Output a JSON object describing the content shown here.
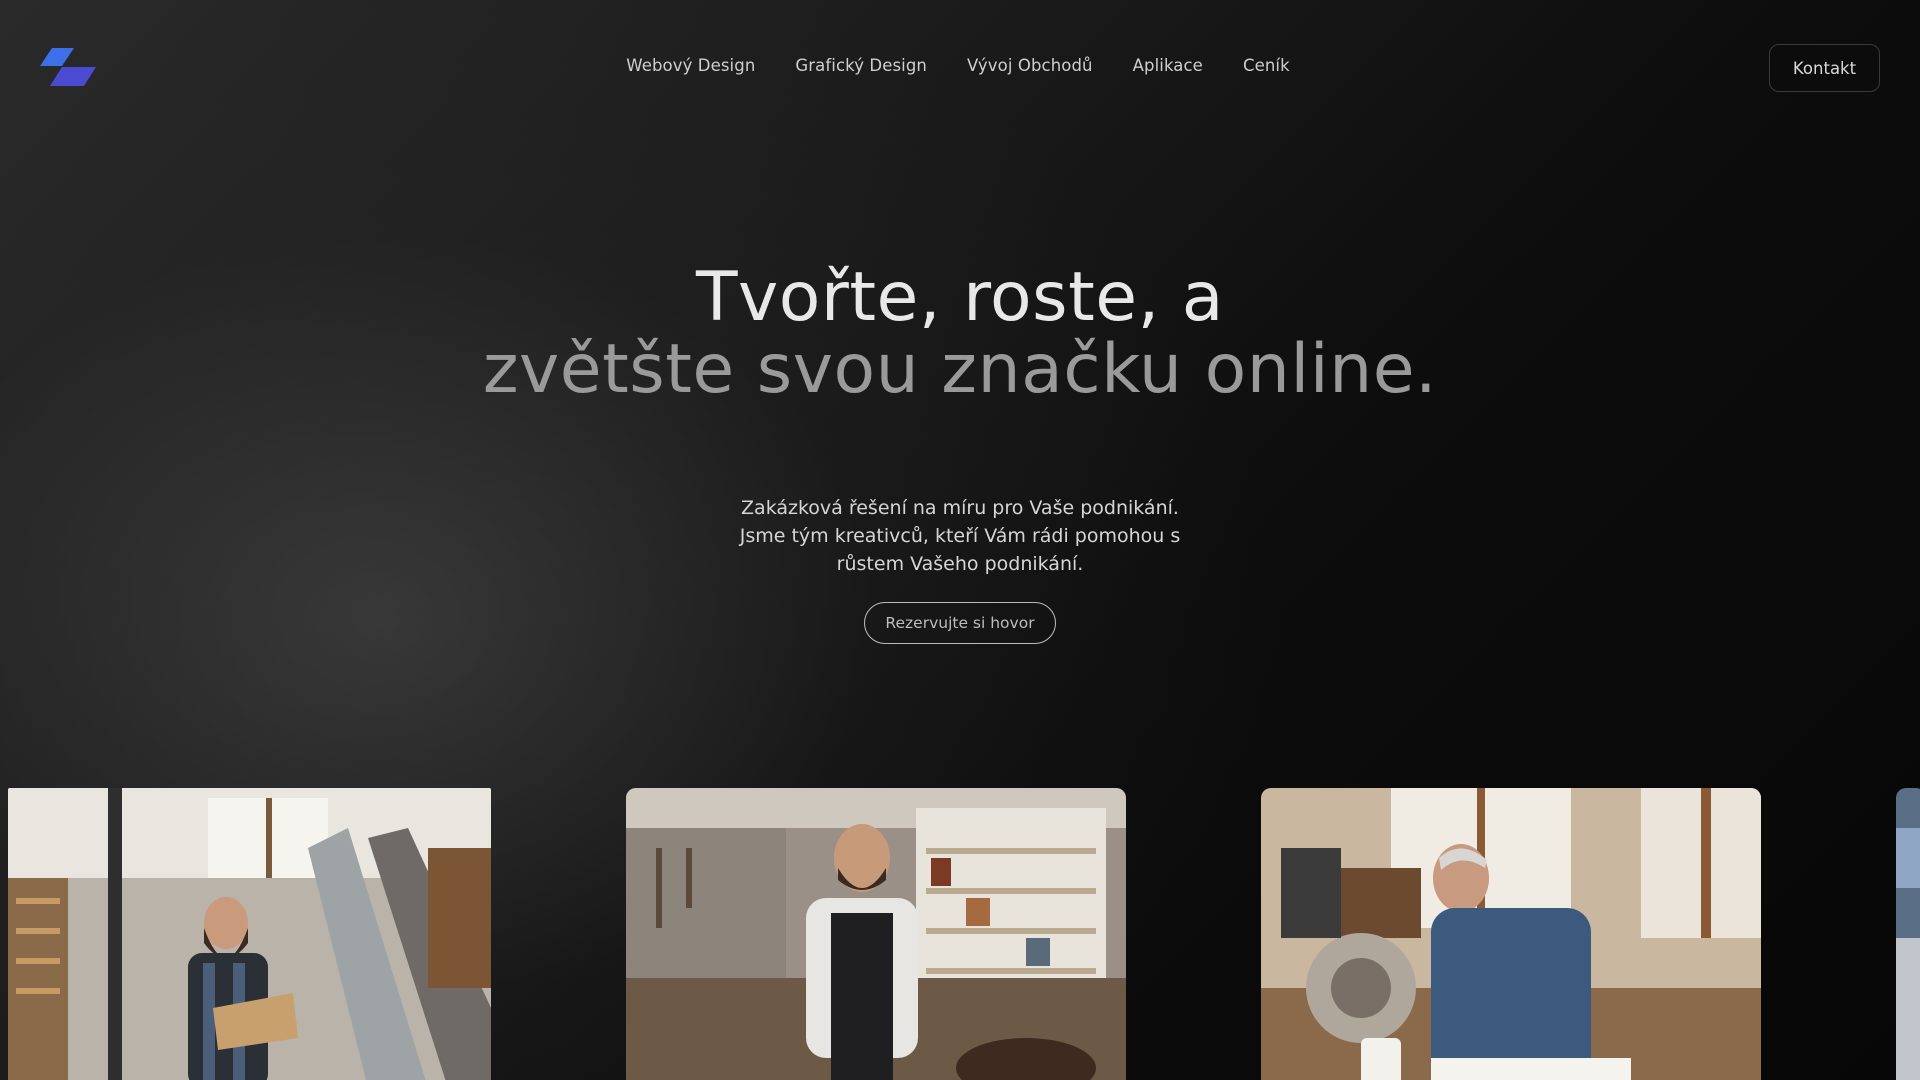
{
  "header": {
    "logo_icon": "brand-parallelogram-logo",
    "nav": [
      {
        "label": "Webový Design"
      },
      {
        "label": "Grafický Design"
      },
      {
        "label": "Vývoj Obchodů"
      },
      {
        "label": "Aplikace"
      },
      {
        "label": "Ceník"
      }
    ],
    "contact_label": "Kontakt"
  },
  "hero": {
    "title_line1": "Tvořte, roste, a",
    "title_line2": "zvětšte svou značku online.",
    "subtitle_lines": [
      "Zakázková řešení na míru pro Vaše podnikání.",
      "Jsme tým kreativců, kteří Vám rádi pomohou s",
      "růstem Vašeho podnikání."
    ],
    "cta_label": "Rezervujte si hovor"
  },
  "gallery": {
    "photos": [
      {
        "subject": "craftsman-with-clipboard-photo"
      },
      {
        "subject": "craftsman-in-apron-photo"
      },
      {
        "subject": "older-craftsman-at-workbench-photo"
      },
      {
        "subject": "partial-workshop-photo"
      }
    ]
  },
  "colors": {
    "logo_top": "#3d6fe8",
    "logo_bottom": "#4a4ad0",
    "background": "#0a0a0a"
  }
}
